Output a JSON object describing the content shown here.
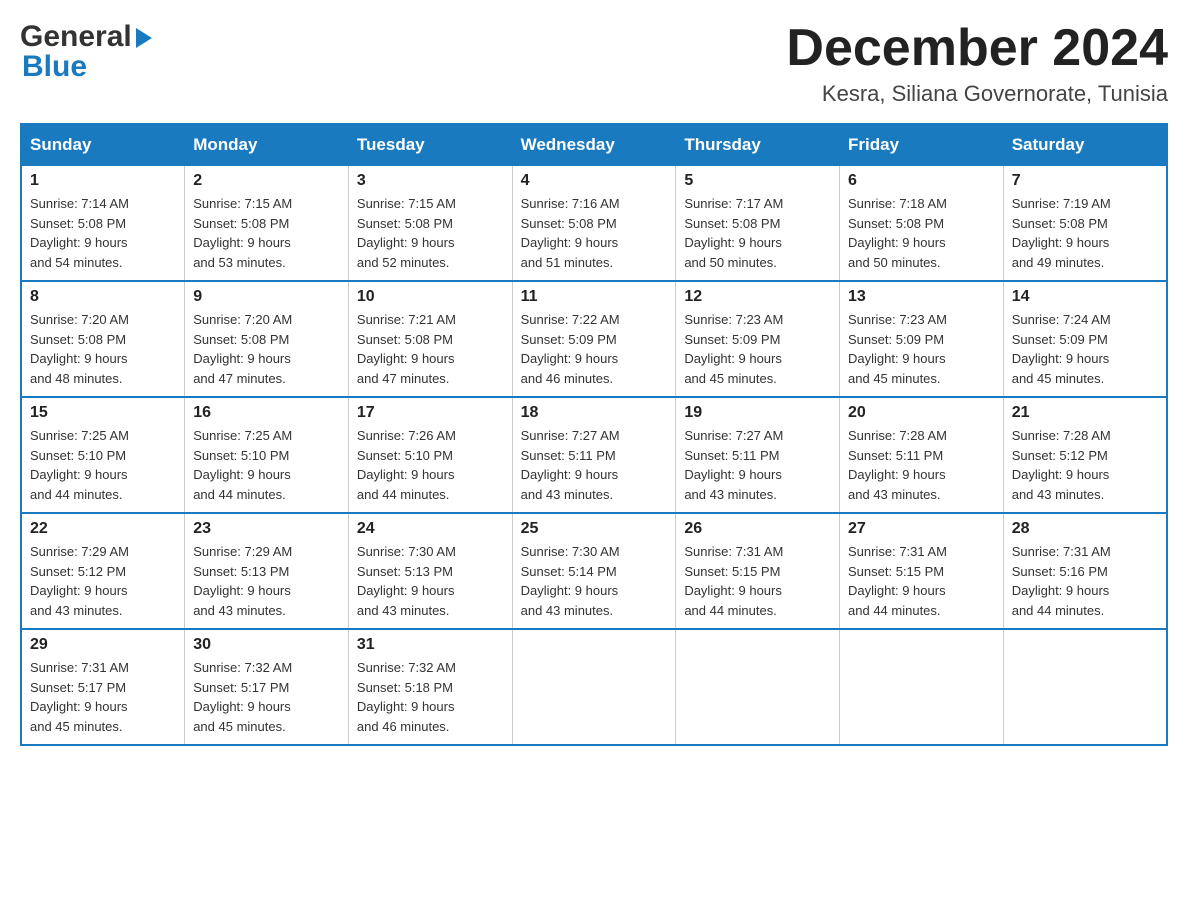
{
  "header": {
    "month_title": "December 2024",
    "location": "Kesra, Siliana Governorate, Tunisia",
    "logo_part1": "General",
    "logo_part2": "Blue"
  },
  "days_of_week": [
    "Sunday",
    "Monday",
    "Tuesday",
    "Wednesday",
    "Thursday",
    "Friday",
    "Saturday"
  ],
  "weeks": [
    [
      {
        "day": "1",
        "sunrise": "7:14 AM",
        "sunset": "5:08 PM",
        "daylight": "9 hours and 54 minutes."
      },
      {
        "day": "2",
        "sunrise": "7:15 AM",
        "sunset": "5:08 PM",
        "daylight": "9 hours and 53 minutes."
      },
      {
        "day": "3",
        "sunrise": "7:15 AM",
        "sunset": "5:08 PM",
        "daylight": "9 hours and 52 minutes."
      },
      {
        "day": "4",
        "sunrise": "7:16 AM",
        "sunset": "5:08 PM",
        "daylight": "9 hours and 51 minutes."
      },
      {
        "day": "5",
        "sunrise": "7:17 AM",
        "sunset": "5:08 PM",
        "daylight": "9 hours and 50 minutes."
      },
      {
        "day": "6",
        "sunrise": "7:18 AM",
        "sunset": "5:08 PM",
        "daylight": "9 hours and 50 minutes."
      },
      {
        "day": "7",
        "sunrise": "7:19 AM",
        "sunset": "5:08 PM",
        "daylight": "9 hours and 49 minutes."
      }
    ],
    [
      {
        "day": "8",
        "sunrise": "7:20 AM",
        "sunset": "5:08 PM",
        "daylight": "9 hours and 48 minutes."
      },
      {
        "day": "9",
        "sunrise": "7:20 AM",
        "sunset": "5:08 PM",
        "daylight": "9 hours and 47 minutes."
      },
      {
        "day": "10",
        "sunrise": "7:21 AM",
        "sunset": "5:08 PM",
        "daylight": "9 hours and 47 minutes."
      },
      {
        "day": "11",
        "sunrise": "7:22 AM",
        "sunset": "5:09 PM",
        "daylight": "9 hours and 46 minutes."
      },
      {
        "day": "12",
        "sunrise": "7:23 AM",
        "sunset": "5:09 PM",
        "daylight": "9 hours and 45 minutes."
      },
      {
        "day": "13",
        "sunrise": "7:23 AM",
        "sunset": "5:09 PM",
        "daylight": "9 hours and 45 minutes."
      },
      {
        "day": "14",
        "sunrise": "7:24 AM",
        "sunset": "5:09 PM",
        "daylight": "9 hours and 45 minutes."
      }
    ],
    [
      {
        "day": "15",
        "sunrise": "7:25 AM",
        "sunset": "5:10 PM",
        "daylight": "9 hours and 44 minutes."
      },
      {
        "day": "16",
        "sunrise": "7:25 AM",
        "sunset": "5:10 PM",
        "daylight": "9 hours and 44 minutes."
      },
      {
        "day": "17",
        "sunrise": "7:26 AM",
        "sunset": "5:10 PM",
        "daylight": "9 hours and 44 minutes."
      },
      {
        "day": "18",
        "sunrise": "7:27 AM",
        "sunset": "5:11 PM",
        "daylight": "9 hours and 43 minutes."
      },
      {
        "day": "19",
        "sunrise": "7:27 AM",
        "sunset": "5:11 PM",
        "daylight": "9 hours and 43 minutes."
      },
      {
        "day": "20",
        "sunrise": "7:28 AM",
        "sunset": "5:11 PM",
        "daylight": "9 hours and 43 minutes."
      },
      {
        "day": "21",
        "sunrise": "7:28 AM",
        "sunset": "5:12 PM",
        "daylight": "9 hours and 43 minutes."
      }
    ],
    [
      {
        "day": "22",
        "sunrise": "7:29 AM",
        "sunset": "5:12 PM",
        "daylight": "9 hours and 43 minutes."
      },
      {
        "day": "23",
        "sunrise": "7:29 AM",
        "sunset": "5:13 PM",
        "daylight": "9 hours and 43 minutes."
      },
      {
        "day": "24",
        "sunrise": "7:30 AM",
        "sunset": "5:13 PM",
        "daylight": "9 hours and 43 minutes."
      },
      {
        "day": "25",
        "sunrise": "7:30 AM",
        "sunset": "5:14 PM",
        "daylight": "9 hours and 43 minutes."
      },
      {
        "day": "26",
        "sunrise": "7:31 AM",
        "sunset": "5:15 PM",
        "daylight": "9 hours and 44 minutes."
      },
      {
        "day": "27",
        "sunrise": "7:31 AM",
        "sunset": "5:15 PM",
        "daylight": "9 hours and 44 minutes."
      },
      {
        "day": "28",
        "sunrise": "7:31 AM",
        "sunset": "5:16 PM",
        "daylight": "9 hours and 44 minutes."
      }
    ],
    [
      {
        "day": "29",
        "sunrise": "7:31 AM",
        "sunset": "5:17 PM",
        "daylight": "9 hours and 45 minutes."
      },
      {
        "day": "30",
        "sunrise": "7:32 AM",
        "sunset": "5:17 PM",
        "daylight": "9 hours and 45 minutes."
      },
      {
        "day": "31",
        "sunrise": "7:32 AM",
        "sunset": "5:18 PM",
        "daylight": "9 hours and 46 minutes."
      },
      null,
      null,
      null,
      null
    ]
  ],
  "labels": {
    "sunrise": "Sunrise: ",
    "sunset": "Sunset: ",
    "daylight": "Daylight: "
  }
}
